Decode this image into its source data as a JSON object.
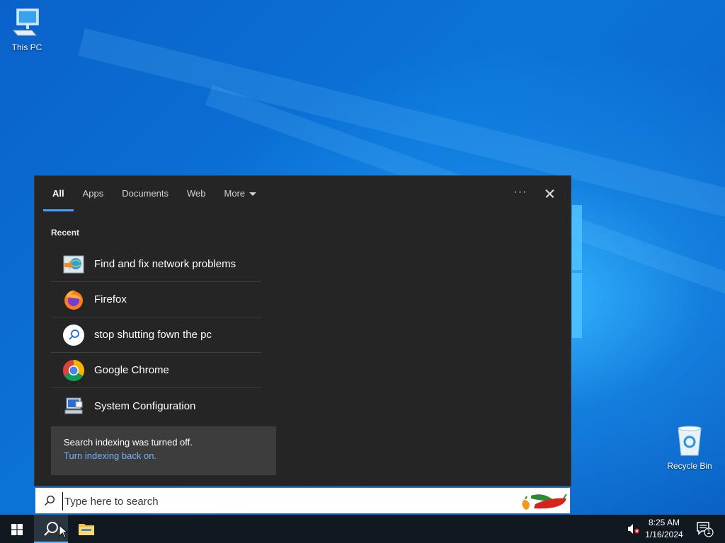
{
  "desktop": {
    "icons": [
      {
        "label": "This PC",
        "icon": "computer-icon"
      },
      {
        "label": "Recycle Bin",
        "icon": "recycle-bin-icon"
      }
    ]
  },
  "search_panel": {
    "tabs": [
      {
        "label": "All",
        "active": true
      },
      {
        "label": "Apps"
      },
      {
        "label": "Documents"
      },
      {
        "label": "Web"
      },
      {
        "label": "More"
      }
    ],
    "options_label": "···",
    "recent_heading": "Recent",
    "recent_items": [
      {
        "label": "Find and fix network problems",
        "icon": "network-troubleshooter-icon"
      },
      {
        "label": "Firefox",
        "icon": "firefox-icon"
      },
      {
        "label": "stop shutting fown the pc",
        "icon": "search-history-icon"
      },
      {
        "label": "Google Chrome",
        "icon": "chrome-icon"
      },
      {
        "label": "System Configuration",
        "icon": "system-configuration-icon"
      }
    ],
    "notice": {
      "text": "Search indexing was turned off.",
      "link": "Turn indexing back on."
    }
  },
  "search_box": {
    "placeholder": "Type here to search",
    "value": ""
  },
  "taskbar": {
    "clock": {
      "time": "8:25 AM",
      "date": "1/16/2024"
    },
    "notification_count": "1"
  },
  "colors": {
    "accent": "#4aa0ff",
    "panel_bg": "#252525",
    "link": "#6fb4f4"
  }
}
